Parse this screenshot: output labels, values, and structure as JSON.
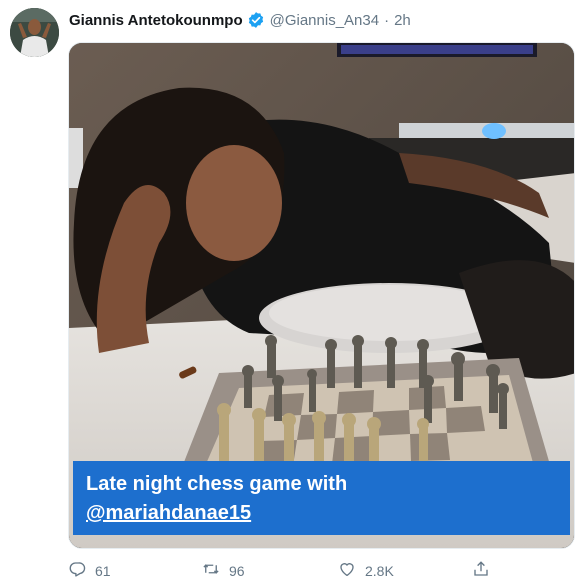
{
  "tweet": {
    "author_name": "Giannis Antetokounmpo",
    "author_handle": "@Giannis_An34",
    "separator": "·",
    "time": "2h",
    "caption_line1": "Late night chess game with",
    "caption_mention": "@mariahdanae15"
  },
  "actions": {
    "reply_count": "61",
    "retweet_count": "96",
    "like_count": "2.8K"
  },
  "colors": {
    "verified": "#1da1f2",
    "caption_bg": "#1d6fce",
    "muted": "#657786"
  }
}
